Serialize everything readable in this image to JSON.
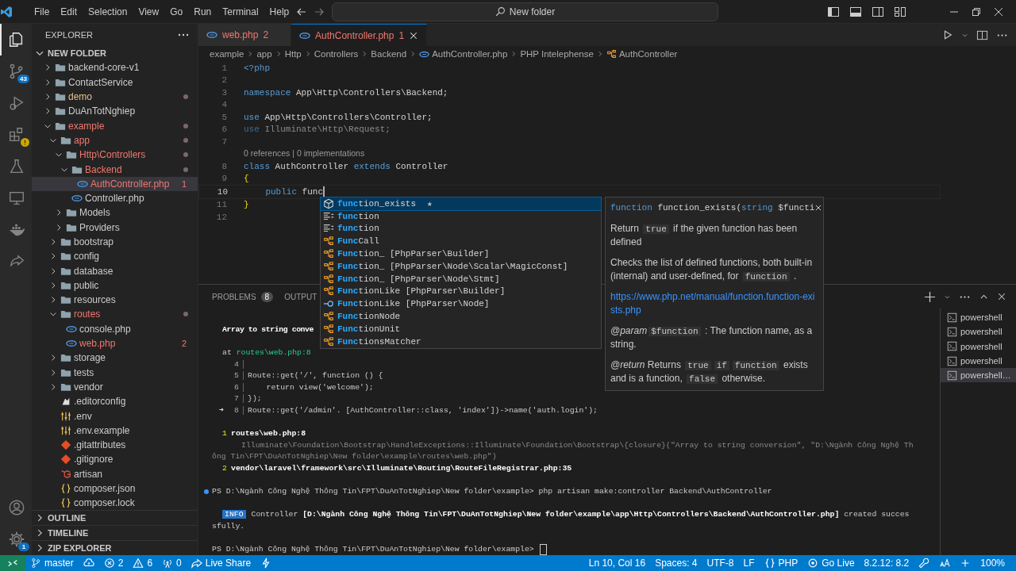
{
  "titlebar": {
    "menus": [
      "File",
      "Edit",
      "Selection",
      "View",
      "Go",
      "Run",
      "Terminal",
      "Help"
    ],
    "search": "New folder"
  },
  "activity_bar": {
    "items": [
      {
        "kind": "files",
        "selected": true
      },
      {
        "kind": "scm",
        "selected": false,
        "badge": "43"
      },
      {
        "kind": "debug",
        "selected": false
      },
      {
        "kind": "extensions",
        "selected": false
      },
      {
        "kind": "testing",
        "selected": false
      },
      {
        "kind": "remote",
        "selected": false
      },
      {
        "kind": "docker",
        "selected": false
      },
      {
        "kind": "liveshare",
        "selected": false
      }
    ],
    "bottom": [
      {
        "kind": "account"
      },
      {
        "kind": "settings",
        "badge": "1"
      }
    ]
  },
  "sidebar": {
    "title": "EXPLORER",
    "root": {
      "label": "NEW FOLDER",
      "expanded": true
    },
    "tree": [
      {
        "name": "backend-core-v1",
        "kind": "folder",
        "color": "#cccccc",
        "selected": false,
        "dot": false,
        "expanded": false
      },
      {
        "name": "ContactService",
        "kind": "folder",
        "color": "#cccccc",
        "selected": false,
        "dot": false,
        "expanded": false
      },
      {
        "name": "demo",
        "kind": "folder",
        "color": "#e2c08d",
        "selected": false,
        "dot": true,
        "expanded": false
      },
      {
        "name": "DuAnTotNghiep",
        "kind": "folder",
        "color": "#cccccc",
        "selected": false,
        "dot": false,
        "expanded": false
      },
      {
        "name": "example",
        "kind": "folder",
        "color": "#f0776f",
        "selected": false,
        "dot": true,
        "expanded": true,
        "children": [
          {
            "name": "app",
            "kind": "folder",
            "color": "#f0776f",
            "selected": false,
            "dot": true,
            "expanded": true,
            "children": [
              {
                "name": "Http\\Controllers",
                "kind": "folder",
                "color": "#f0776f",
                "selected": false,
                "dot": true,
                "expanded": true,
                "children": [
                  {
                    "name": "Backend",
                    "kind": "folder",
                    "color": "#f0776f",
                    "selected": false,
                    "dot": true,
                    "expanded": true,
                    "children": [
                      {
                        "name": "AuthController.php",
                        "kind": "php",
                        "color": "#f0776f",
                        "selected": true,
                        "dot": false,
                        "badge": "1"
                      }
                    ]
                  },
                  {
                    "name": "Controller.php",
                    "kind": "php",
                    "color": "#cccccc",
                    "selected": false,
                    "dot": false
                  }
                ]
              },
              {
                "name": "Models",
                "kind": "folder",
                "color": "#cccccc",
                "selected": false,
                "dot": false,
                "expanded": false
              },
              {
                "name": "Providers",
                "kind": "folder",
                "color": "#cccccc",
                "selected": false,
                "dot": false,
                "expanded": false
              }
            ]
          },
          {
            "name": "bootstrap",
            "kind": "folder",
            "color": "#cccccc",
            "selected": false,
            "dot": false,
            "expanded": false
          },
          {
            "name": "config",
            "kind": "folder",
            "color": "#cccccc",
            "selected": false,
            "dot": false,
            "expanded": false
          },
          {
            "name": "database",
            "kind": "folder",
            "color": "#cccccc",
            "selected": false,
            "dot": false,
            "expanded": false
          },
          {
            "name": "public",
            "kind": "folder",
            "color": "#cccccc",
            "selected": false,
            "dot": false,
            "expanded": false
          },
          {
            "name": "resources",
            "kind": "folder",
            "color": "#cccccc",
            "selected": false,
            "dot": false,
            "expanded": false
          },
          {
            "name": "routes",
            "kind": "folder",
            "color": "#f0776f",
            "selected": false,
            "dot": true,
            "expanded": true,
            "children": [
              {
                "name": "console.php",
                "kind": "php",
                "color": "#cccccc",
                "selected": false,
                "dot": false
              },
              {
                "name": "web.php",
                "kind": "php",
                "color": "#f0776f",
                "selected": false,
                "dot": false,
                "badge": "2"
              }
            ]
          },
          {
            "name": "storage",
            "kind": "folder",
            "color": "#cccccc",
            "selected": false,
            "dot": false,
            "expanded": false
          },
          {
            "name": "tests",
            "kind": "folder",
            "color": "#cccccc",
            "selected": false,
            "dot": false,
            "expanded": false
          },
          {
            "name": "vendor",
            "kind": "folder",
            "color": "#cccccc",
            "selected": false,
            "dot": false,
            "expanded": false
          },
          {
            "name": ".editorconfig",
            "kind": "editorconfig",
            "color": "#cccccc",
            "selected": false,
            "dot": false
          },
          {
            "name": ".env",
            "kind": "env",
            "color": "#cccccc",
            "selected": false,
            "dot": false
          },
          {
            "name": ".env.example",
            "kind": "env",
            "color": "#cccccc",
            "selected": false,
            "dot": false
          },
          {
            "name": ".gitattributes",
            "kind": "git",
            "color": "#cccccc",
            "selected": false,
            "dot": false
          },
          {
            "name": ".gitignore",
            "kind": "git",
            "color": "#cccccc",
            "selected": false,
            "dot": false
          },
          {
            "name": "artisan",
            "kind": "laravel",
            "color": "#cccccc",
            "selected": false,
            "dot": false
          },
          {
            "name": "composer.json",
            "kind": "json",
            "color": "#cccccc",
            "selected": false,
            "dot": false
          },
          {
            "name": "composer.lock",
            "kind": "json",
            "color": "#cccccc",
            "selected": false,
            "dot": false
          }
        ]
      }
    ],
    "sections": [
      {
        "label": "OUTLINE",
        "expanded": false
      },
      {
        "label": "TIMELINE",
        "expanded": false
      },
      {
        "label": "ZIP EXPLORER",
        "expanded": false
      }
    ]
  },
  "editor": {
    "tabs": [
      {
        "label": "web.php",
        "badge": "2",
        "selected": false
      },
      {
        "label": "AuthController.php",
        "badge": "1",
        "selected": true
      }
    ],
    "breadcrumbs": [
      {
        "kind": "folder",
        "text": "example"
      },
      {
        "kind": "folder",
        "text": "app"
      },
      {
        "kind": "folder",
        "text": "Http"
      },
      {
        "kind": "folder",
        "text": "Controllers"
      },
      {
        "kind": "folder",
        "text": "Backend"
      },
      {
        "kind": "php",
        "text": "AuthController.php"
      },
      {
        "kind": "folder",
        "text": "PHP Intelephense"
      },
      {
        "kind": "class",
        "text": "AuthController"
      }
    ],
    "lines": [
      {
        "number": "1",
        "current": false,
        "tokens": [
          {
            "kind": "keyword",
            "text": "<?php"
          }
        ]
      },
      {
        "number": "2",
        "current": false
      },
      {
        "number": "3",
        "current": false,
        "tokens": [
          {
            "kind": "keyword",
            "text": "namespace"
          },
          {
            "kind": "plain",
            "text": " App\\Http\\Controllers\\Backend;"
          }
        ]
      },
      {
        "number": "4",
        "current": false
      },
      {
        "number": "5",
        "current": false,
        "tokens": [
          {
            "kind": "keyword",
            "text": "use"
          },
          {
            "kind": "plain",
            "text": " App\\Http\\Controllers\\Controller;"
          }
        ]
      },
      {
        "number": "6",
        "current": false,
        "tokens": [
          {
            "kind": "dim-keyword",
            "text": "use"
          },
          {
            "kind": "dim",
            "text": " Illuminate\\Http\\Request;"
          }
        ]
      },
      {
        "number": "7",
        "current": false
      },
      {
        "number": "8",
        "current": false,
        "codelens": "0 references | 0 implementations",
        "tokens": [
          {
            "kind": "keyword",
            "text": "class"
          },
          {
            "kind": "plain",
            "text": " AuthController "
          },
          {
            "kind": "keyword",
            "text": "extends"
          },
          {
            "kind": "plain",
            "text": " Controller"
          }
        ]
      },
      {
        "number": "9",
        "current": false,
        "tokens": [
          {
            "kind": "brace",
            "text": "{"
          }
        ]
      },
      {
        "number": "10",
        "current": true,
        "tokens": [
          {
            "kind": "keyword",
            "text": "    public"
          },
          {
            "kind": "plain",
            "text": " func"
          }
        ]
      },
      {
        "number": "11",
        "current": false,
        "tokens": [
          {
            "kind": "brace",
            "text": "}"
          }
        ]
      },
      {
        "number": "12",
        "current": false
      }
    ]
  },
  "suggest": {
    "items": [
      {
        "kind": "function",
        "label": "function_exists",
        "star": "★",
        "selected": true
      },
      {
        "kind": "snippet",
        "label": "function",
        "selected": false
      },
      {
        "kind": "snippet",
        "label": "function",
        "selected": false
      },
      {
        "kind": "class",
        "label": "FuncCall",
        "selected": false
      },
      {
        "kind": "class",
        "label": "Function_",
        "detail": "[PhpParser\\Builder]",
        "selected": false
      },
      {
        "kind": "class",
        "label": "Function_",
        "detail": "[PhpParser\\Node\\Scalar\\MagicConst]",
        "selected": false
      },
      {
        "kind": "class",
        "label": "Function_",
        "detail": "[PhpParser\\Node\\Stmt]",
        "selected": false
      },
      {
        "kind": "class",
        "label": "FunctionLike",
        "detail": "[PhpParser\\Builder]",
        "selected": false
      },
      {
        "kind": "interface",
        "label": "FunctionLike",
        "detail": "[PhpParser\\Node]",
        "selected": false
      },
      {
        "kind": "class",
        "label": "FunctionNode",
        "selected": false
      },
      {
        "kind": "class",
        "label": "FunctionUnit",
        "selected": false
      },
      {
        "kind": "class",
        "label": "FunctionsMatcher",
        "selected": false
      }
    ]
  },
  "hover": {
    "signature": [
      {
        "kind": "keyword",
        "text": "function"
      },
      {
        "kind": "plain",
        "text": " function_exists("
      },
      {
        "kind": "type",
        "text": "string"
      },
      {
        "kind": "plain",
        "text": " $functi"
      }
    ],
    "paragraphs": [
      {
        "kind": "text",
        "parts": [
          {
            "kind": "text",
            "text": "Return "
          },
          {
            "kind": "code",
            "text": "true"
          },
          {
            "kind": "text",
            "text": " if the given function has been defined"
          }
        ]
      },
      {
        "kind": "text",
        "parts": [
          {
            "kind": "text",
            "text": "Checks the list of defined functions, both built-in (internal) and user-defined, for "
          },
          {
            "kind": "code",
            "text": "function"
          },
          {
            "kind": "text",
            "text": " ."
          }
        ]
      },
      {
        "kind": "link",
        "text": "https://www.php.net/manual/function.function-exists.php"
      },
      {
        "kind": "text",
        "parts": [
          {
            "kind": "tag",
            "text": "@param"
          },
          {
            "kind": "code",
            "text": "$function"
          },
          {
            "kind": "text",
            "text": " : The function name, as a string."
          }
        ]
      },
      {
        "kind": "text",
        "parts": [
          {
            "kind": "tag",
            "text": "@return"
          },
          {
            "kind": "text",
            "text": " Returns "
          },
          {
            "kind": "code",
            "text": "true"
          },
          {
            "kind": "code",
            "text": "if"
          },
          {
            "kind": "code",
            "text": "function"
          },
          {
            "kind": "text",
            "text": " exists and is a function, "
          },
          {
            "kind": "code",
            "text": "false"
          },
          {
            "kind": "text",
            "text": " otherwise."
          }
        ]
      }
    ]
  },
  "panel": {
    "tabs": [
      {
        "label": "PROBLEMS",
        "badge": "8",
        "selected": false
      },
      {
        "label": "OUTPUT",
        "selected": false
      }
    ],
    "terminal": [
      [
        {
          "kind": "error",
          "parts": [
            {
              "kind": "bold",
              "text": "Array to string conve"
            }
          ]
        }
      ],
      [
        {
          "kind": "location",
          "parts": [
            {
              "kind": "text",
              "text": "at "
            },
            {
              "kind": "link",
              "text": "routes\\web.php:8"
            }
          ]
        },
        {
          "kind": "excerpt",
          "number": "4"
        },
        {
          "kind": "excerpt",
          "number": "5",
          "parts": [
            {
              "kind": "text",
              "text": "Route::get('/', function () {"
            }
          ]
        },
        {
          "kind": "excerpt",
          "number": "6",
          "parts": [
            {
              "kind": "text",
              "text": "    return view('welcome');"
            }
          ]
        },
        {
          "kind": "excerpt",
          "number": "7",
          "parts": [
            {
              "kind": "text",
              "text": "});"
            }
          ]
        },
        {
          "kind": "excerpt",
          "marker": "➜",
          "number": "8",
          "parts": [
            {
              "kind": "text",
              "text": "Route::get('/admin'. [AuthController::class, 'index'])->name('auth.login');"
            }
          ]
        }
      ],
      [
        {
          "kind": "frame",
          "number": "1",
          "parts": [
            {
              "kind": "bold",
              "text": "routes\\web.php:8"
            }
          ]
        },
        {
          "kind": "detail",
          "parts": [
            {
              "kind": "muted",
              "text": "Illuminate\\Foundation\\Bootstrap\\HandleExceptions::Illuminate\\Foundation\\Bootstrap\\{closure}(\"Array to string conversion\", \"D:\\Ngành Công Nghệ Th"
            }
          ]
        },
        {
          "kind": "wrap",
          "parts": [
            {
              "kind": "muted",
              "text": "ông Tin\\FPT\\DuAnTotNghiep\\New folder\\example\\routes\\web.php\")"
            }
          ]
        },
        {
          "kind": "frame",
          "number": "2",
          "parts": [
            {
              "kind": "bold",
              "text": "vendor\\laravel\\framework\\src\\Illuminate\\Routing\\RouteFileRegistrar.php:35"
            }
          ]
        }
      ],
      [
        {
          "kind": "command",
          "parts": [
            {
              "kind": "text",
              "text": "PS D:\\Ngành Công Nghệ Thông Tin\\FPT\\DuAnTotNghiep\\New folder\\example> php artisan make:controller Backend\\AuthController"
            }
          ]
        }
      ],
      [
        {
          "kind": "info",
          "badge": "INFO",
          "parts": [
            {
              "kind": "text",
              "text": "Controller "
            },
            {
              "kind": "bold",
              "text": "[D:\\Ngành Công Nghệ Thông Tin\\FPT\\DuAnTotNghiep\\New folder\\example\\app\\Http\\Controllers\\Backend\\AuthController.php]"
            },
            {
              "kind": "text",
              "text": " created succes"
            }
          ]
        },
        {
          "kind": "wrap",
          "parts": [
            {
              "kind": "text",
              "text": "sfully."
            }
          ]
        }
      ],
      [
        {
          "kind": "prompt",
          "parts": [
            {
              "kind": "text",
              "text": "PS D:\\Ngành Công Nghệ Thông Tin\\FPT\\DuAnTotNghiep\\New folder\\example> "
            }
          ]
        }
      ]
    ],
    "terminals": [
      {
        "label": "powershell",
        "selected": false
      },
      {
        "label": "powershell",
        "selected": false
      },
      {
        "label": "powershell",
        "selected": false
      },
      {
        "label": "powershell",
        "selected": false
      },
      {
        "label": "powershell…",
        "selected": true
      }
    ]
  },
  "status_bar": {
    "left": [
      {
        "kind": "remote"
      },
      {
        "kind": "branch",
        "text": "master"
      },
      {
        "kind": "sync"
      },
      {
        "kind": "errors",
        "text": "2"
      },
      {
        "kind": "warnings",
        "text": "6"
      },
      {
        "kind": "ports",
        "text": "0"
      },
      {
        "kind": "liveshare",
        "text": "Live Share"
      },
      {
        "kind": "bolt"
      }
    ],
    "right": [
      {
        "kind": "plain",
        "text": "Ln 10, Col 16"
      },
      {
        "kind": "plain",
        "text": "Spaces: 4"
      },
      {
        "kind": "plain",
        "text": "UTF-8"
      },
      {
        "kind": "plain",
        "text": "LF"
      },
      {
        "kind": "braces",
        "text": "PHP"
      },
      {
        "kind": "golive",
        "text": "Go Live"
      },
      {
        "kind": "plain",
        "text": "8.2.12: 8.2"
      },
      {
        "kind": "key"
      },
      {
        "kind": "font"
      },
      {
        "kind": "plus"
      },
      {
        "kind": "plain",
        "text": "100%"
      }
    ]
  }
}
